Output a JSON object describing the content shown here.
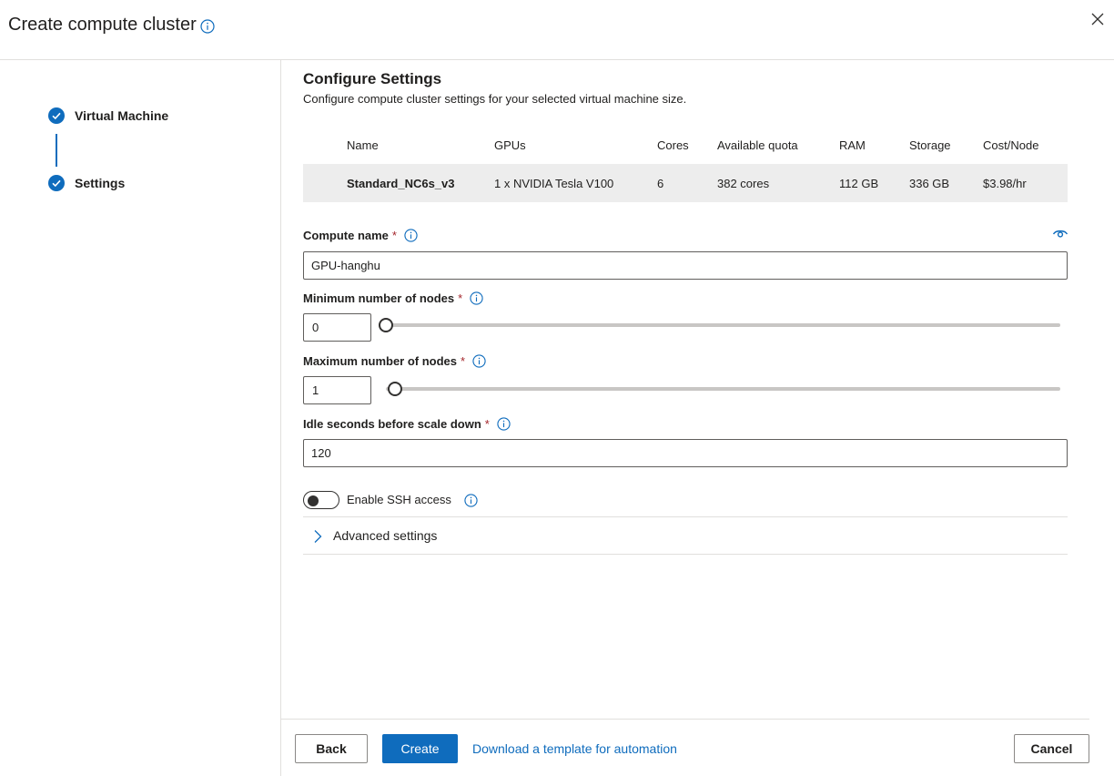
{
  "header": {
    "title": "Create compute cluster"
  },
  "steps": [
    {
      "label": "Virtual Machine"
    },
    {
      "label": "Settings"
    }
  ],
  "section": {
    "title": "Configure Settings",
    "description": "Configure compute cluster settings for your selected virtual machine size."
  },
  "vm_table": {
    "headers": [
      "Name",
      "GPUs",
      "Cores",
      "Available quota",
      "RAM",
      "Storage",
      "Cost/Node"
    ],
    "row": [
      "Standard_NC6s_v3",
      "1 x NVIDIA Tesla V100",
      "6",
      "382 cores",
      "112 GB",
      "336 GB",
      "$3.98/hr"
    ]
  },
  "fields": {
    "compute_name": {
      "label": "Compute name",
      "value": "GPU-hanghu",
      "required": "*"
    },
    "min_nodes": {
      "label": "Minimum number of nodes",
      "value": "0",
      "required": "*",
      "slider_fraction": 0.0
    },
    "max_nodes": {
      "label": "Maximum number of nodes",
      "value": "1",
      "required": "*",
      "slider_fraction": 0.013
    },
    "idle_seconds": {
      "label": "Idle seconds before scale down",
      "value": "120",
      "required": "*"
    }
  },
  "ssh": {
    "label": "Enable SSH access",
    "enabled": false
  },
  "advanced": {
    "label": "Advanced settings"
  },
  "footer": {
    "back": "Back",
    "create": "Create",
    "template_link": "Download a template for automation",
    "cancel": "Cancel"
  },
  "colors": {
    "accent": "#0f6cbd",
    "required": "#a4262c",
    "row_bg": "#ededed"
  }
}
